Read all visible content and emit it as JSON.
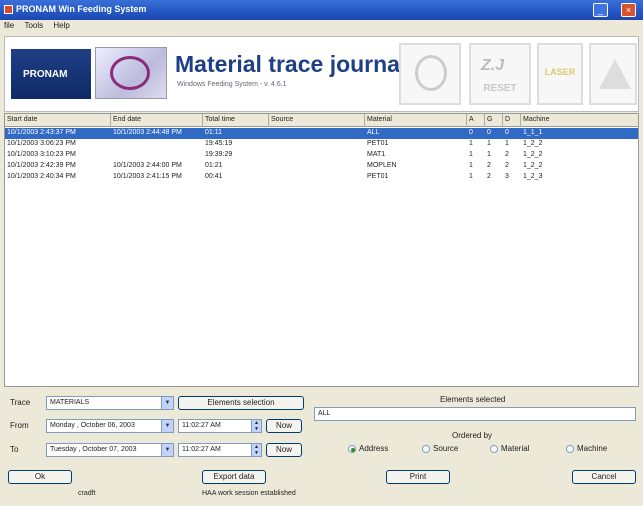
{
  "window": {
    "title": "PRONAM Win Feeding System"
  },
  "menu": [
    "file",
    "Tools",
    "Help"
  ],
  "header": {
    "title": "Material trace journal",
    "subtitle": "Windows Feeding System - v. 4.6.1",
    "logo_text": "PRONAM",
    "reset_label": "RESET",
    "reset_fancy": "Z.J",
    "laser_label": "LASER"
  },
  "table": {
    "columns": [
      "Start date",
      "End date",
      "Total time",
      "Source",
      "Material",
      "A",
      "G",
      "D",
      "Machine"
    ],
    "rows": [
      [
        "10/1/2003 2:43:37 PM",
        "10/1/2003 2:44:48 PM",
        "01:11",
        "",
        "ALL",
        "0",
        "0",
        "0",
        "1_1_1"
      ],
      [
        "10/1/2003 3:06:23 PM",
        "",
        "19:45:19",
        "",
        "PET01",
        "1",
        "1",
        "1",
        "1_2_2"
      ],
      [
        "10/1/2003 3:10:23 PM",
        "",
        "19:39:29",
        "",
        "MAT1",
        "1",
        "1",
        "2",
        "1_2_2"
      ],
      [
        "10/1/2003 2:42:39 PM",
        "10/1/2003 2:44:00 PM",
        "01:21",
        "",
        "MOPLEN",
        "1",
        "2",
        "2",
        "1_2_2"
      ],
      [
        "10/1/2003 2:40:34 PM",
        "10/1/2003 2:41:15 PM",
        "00:41",
        "",
        "PET01",
        "1",
        "2",
        "3",
        "1_2_3"
      ]
    ]
  },
  "filters": {
    "trace_label": "Trace",
    "trace_value": "MATERIALS",
    "elements_selection_btn": "Elements selection",
    "from_label": "From",
    "from_date": "Monday  ,  October  06, 2003",
    "from_time": "11:02:27 AM",
    "to_label": "To",
    "to_date": "Tuesday  ,  October  07, 2003",
    "to_time": "11:02:27 AM",
    "now_btn": "Now"
  },
  "elements": {
    "title": "Elements selected",
    "value": "ALL",
    "ordered_by_label": "Ordered by",
    "options": [
      "Address",
      "Source",
      "Material",
      "Machine"
    ],
    "selected_index": 0
  },
  "actions": {
    "ok": "Ok",
    "export": "Export data",
    "print": "Print",
    "cancel": "Cancel"
  },
  "status": {
    "left": "cradft",
    "center": "HAA work session established"
  }
}
